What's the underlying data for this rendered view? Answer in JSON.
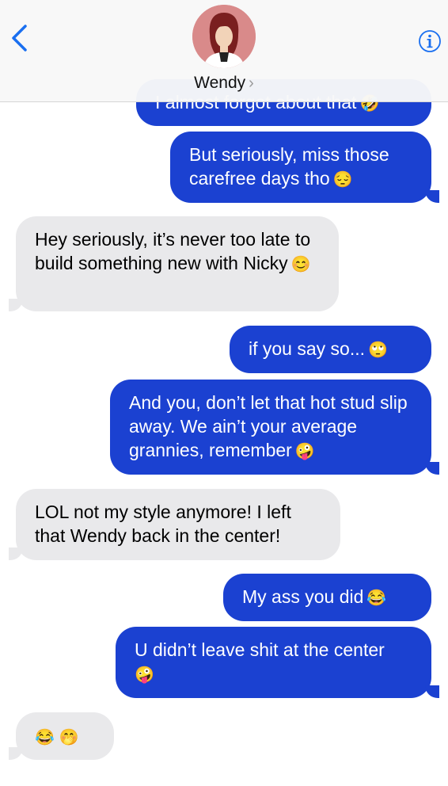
{
  "header": {
    "contact_name": "Wendy",
    "chevron": "›",
    "back_icon": "chevron-left-icon",
    "info_icon": "info-icon"
  },
  "messages": [
    {
      "from": "me",
      "text": "I almost forgot about that",
      "emoji": "🤣"
    },
    {
      "from": "me",
      "text": "But seriously, miss those carefree days tho",
      "emoji": "😔"
    },
    {
      "from": "wendy",
      "text": "Hey seriously, it’s never too late to build something new with Nicky",
      "emoji": "😊"
    },
    {
      "from": "me",
      "text": "if you say so...",
      "emoji": "🙄"
    },
    {
      "from": "me",
      "text": "And you, don’t let that hot stud slip away. We ain’t your average grannies, remember",
      "emoji": "🤪"
    },
    {
      "from": "wendy",
      "text": "LOL not my style anymore! I left that Wendy back in the center!",
      "emoji": ""
    },
    {
      "from": "me",
      "text": "My ass you did",
      "emoji": "😂"
    },
    {
      "from": "me",
      "text": "U didn’t leave shit at the center",
      "emoji": "🤪"
    },
    {
      "from": "wendy",
      "text": "",
      "emoji": "😂 🤭"
    }
  ],
  "colors": {
    "outgoing": "#1b41d1",
    "incoming": "#e9e9eb",
    "accent": "#1a6ff0"
  }
}
